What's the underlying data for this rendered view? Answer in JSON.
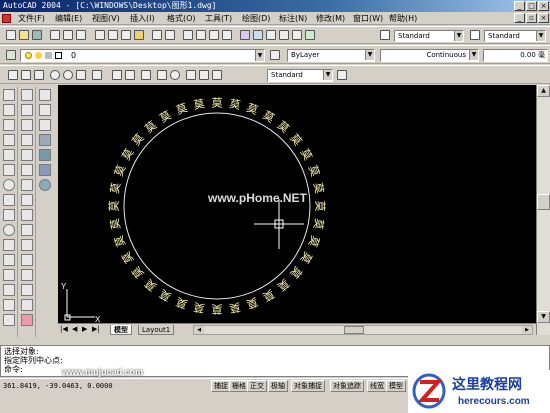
{
  "window": {
    "title": "AutoCAD 2004 - [C:\\WINDOWS\\Desktop\\图形1.dwg]",
    "min": "_",
    "max": "□",
    "close": "×"
  },
  "menu": [
    "文件(F)",
    "编辑(E)",
    "视图(V)",
    "插入(I)",
    "格式(O)",
    "工具(T)",
    "绘图(D)",
    "标注(N)",
    "修改(M)",
    "窗口(W)",
    "帮助(H)"
  ],
  "toolbar": {
    "text_style": "Standard",
    "dim_style": "Standard",
    "layer": "0",
    "color": "ByLayer",
    "linetype": "Continuous",
    "lineweight": "0.00 毫",
    "style2": "Standard"
  },
  "drawing": {
    "ring_char": "莫",
    "watermark": "www.pHome.NET",
    "ucs_x": "X",
    "ucs_y": "Y"
  },
  "tabs": {
    "model": "模型",
    "layout1": "Layout1"
  },
  "command": {
    "line1": "选择对象:",
    "line2": "指定阵列中心点:",
    "prompt": "命令:"
  },
  "status": {
    "coords": "361.8419, -39.0463, 0.0000",
    "site": "www.mujucad.com",
    "buttons": [
      "捕捉",
      "栅格",
      "正交",
      "极轴",
      "对象捕捉",
      "对象追踪",
      "线宽",
      "模型"
    ]
  },
  "logo": {
    "title": "这里教程网",
    "url": "herecours.com"
  }
}
